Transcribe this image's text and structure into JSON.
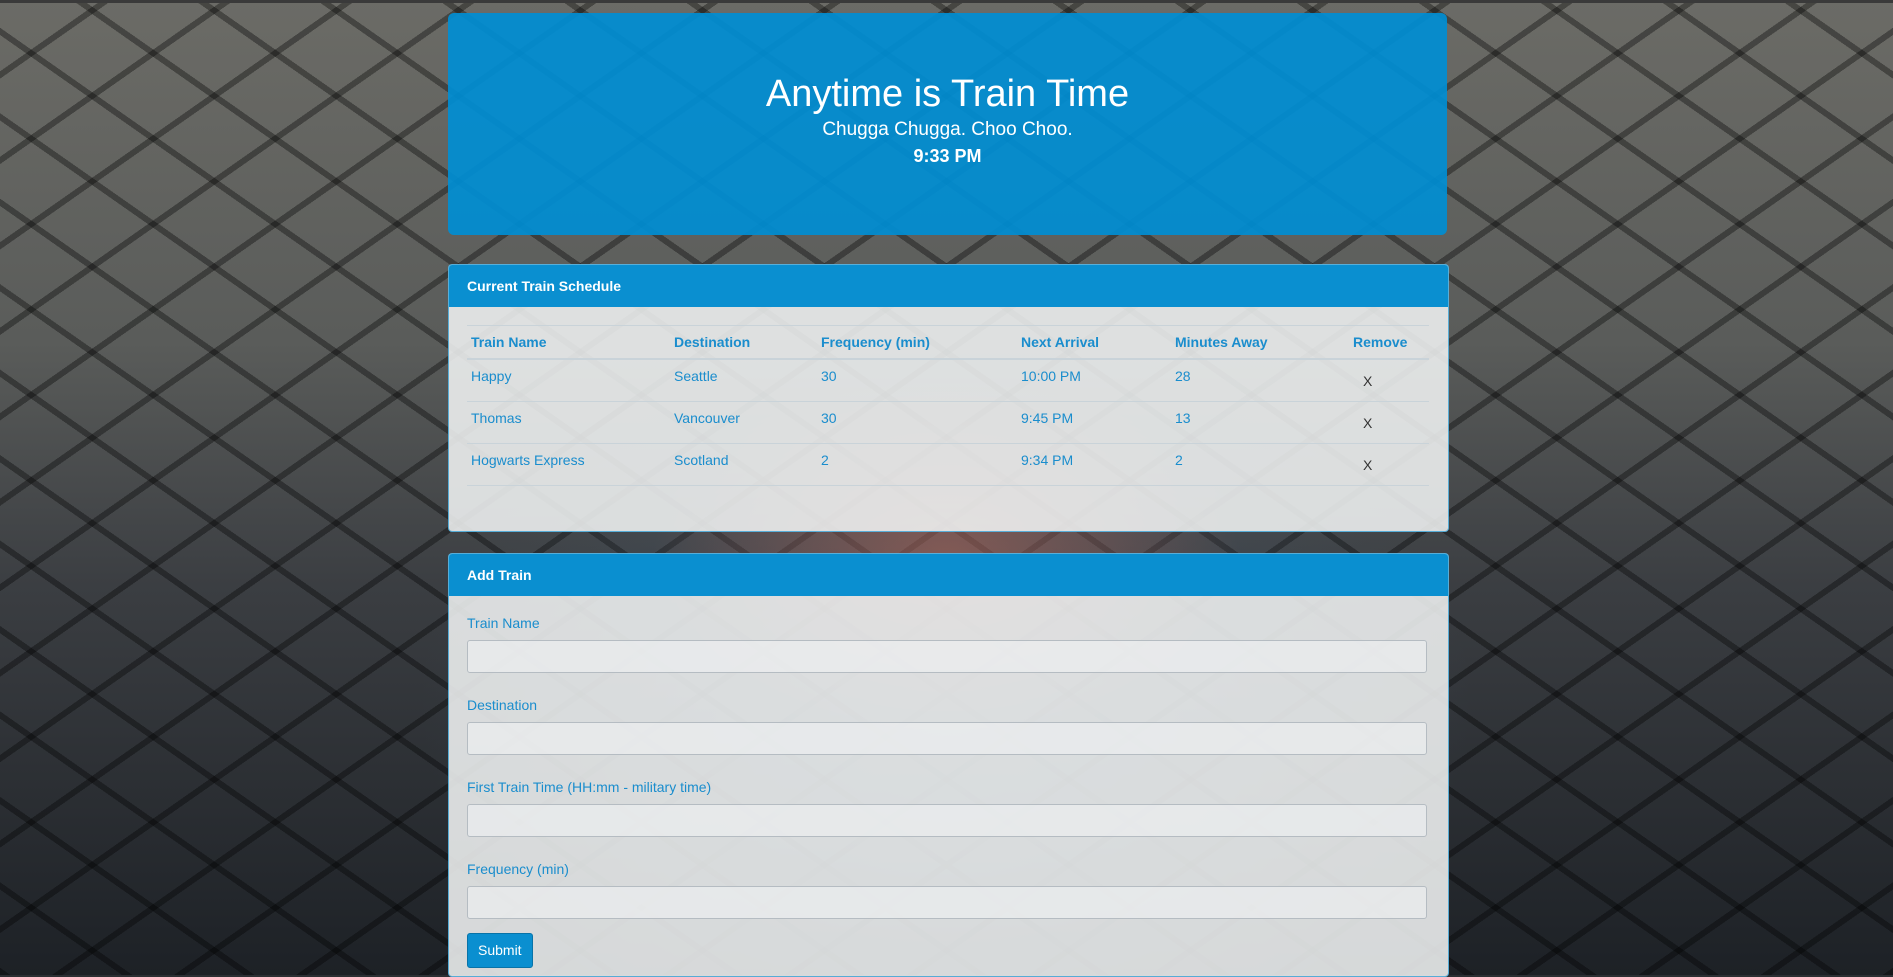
{
  "header": {
    "title": "Anytime is Train Time",
    "subtitle": "Chugga Chugga. Choo Choo.",
    "current_time": "9:33 PM"
  },
  "schedule": {
    "heading": "Current Train Schedule",
    "columns": [
      "Train Name",
      "Destination",
      "Frequency (min)",
      "Next Arrival",
      "Minutes Away",
      "Remove"
    ],
    "rows": [
      [
        "Happy",
        "Seattle",
        "30",
        "10:00 PM",
        "28",
        "X"
      ],
      [
        "Thomas",
        "Vancouver",
        "30",
        "9:45 PM",
        "13",
        "X"
      ],
      [
        "Hogwarts Express",
        "Scotland",
        "2",
        "9:34 PM",
        "2",
        "X"
      ]
    ]
  },
  "add_train": {
    "heading": "Add Train",
    "fields": {
      "train_name": {
        "label": "Train Name",
        "value": ""
      },
      "destination": {
        "label": "Destination",
        "value": ""
      },
      "first_time": {
        "label": "First Train Time (HH:mm - military time)",
        "value": ""
      },
      "frequency": {
        "label": "Frequency (min)",
        "value": ""
      }
    },
    "submit_label": "Submit"
  },
  "colors": {
    "accent": "#0a8fd0",
    "link_text": "#1a8dcd"
  }
}
